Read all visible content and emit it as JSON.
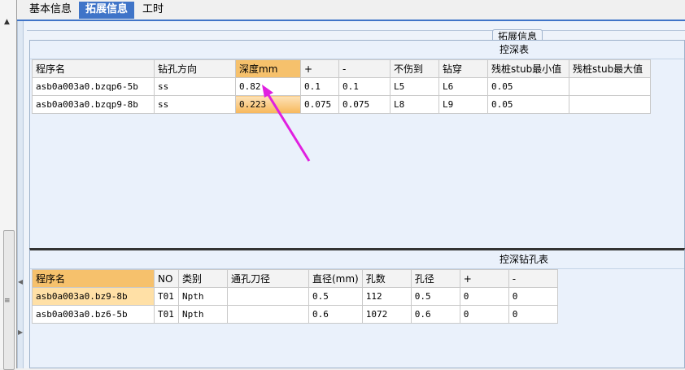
{
  "tabs": [
    {
      "label": "基本信息"
    },
    {
      "label": "拓展信息"
    },
    {
      "label": "工时"
    }
  ],
  "group_label": "拓展信息",
  "top_panel": {
    "title": "控深表",
    "columns": [
      "程序名",
      "钻孔方向",
      "深度mm",
      "+",
      "-",
      "不伤到",
      "钻穿",
      "残桩stub最小值",
      "残桩stub最大值"
    ],
    "rows": [
      [
        "asb0a003a0.bzqp6-5b",
        "ss",
        "0.82",
        "0.1",
        "0.1",
        "L5",
        "L6",
        "0.05",
        ""
      ],
      [
        "asb0a003a0.bzqp9-8b",
        "ss",
        "0.223",
        "0.075",
        "0.075",
        "L8",
        "L9",
        "0.05",
        ""
      ]
    ]
  },
  "bottom_panel": {
    "title": "控深钻孔表",
    "columns": [
      "程序名",
      "NO",
      "类别",
      "通孔刀径",
      "直径(mm)",
      "孔数",
      "孔径",
      "+",
      "-"
    ],
    "rows": [
      [
        "asb0a003a0.bz9-8b",
        "T01",
        "Npth",
        "",
        "0.5",
        "112",
        "0.5",
        "0",
        "0"
      ],
      [
        "asb0a003a0.bz6-5b",
        "T01",
        "Npth",
        "",
        "0.6",
        "1072",
        "0.6",
        "0",
        "0"
      ]
    ]
  },
  "annotation_color": "#e020e0",
  "accent_color": "#3f74c8"
}
